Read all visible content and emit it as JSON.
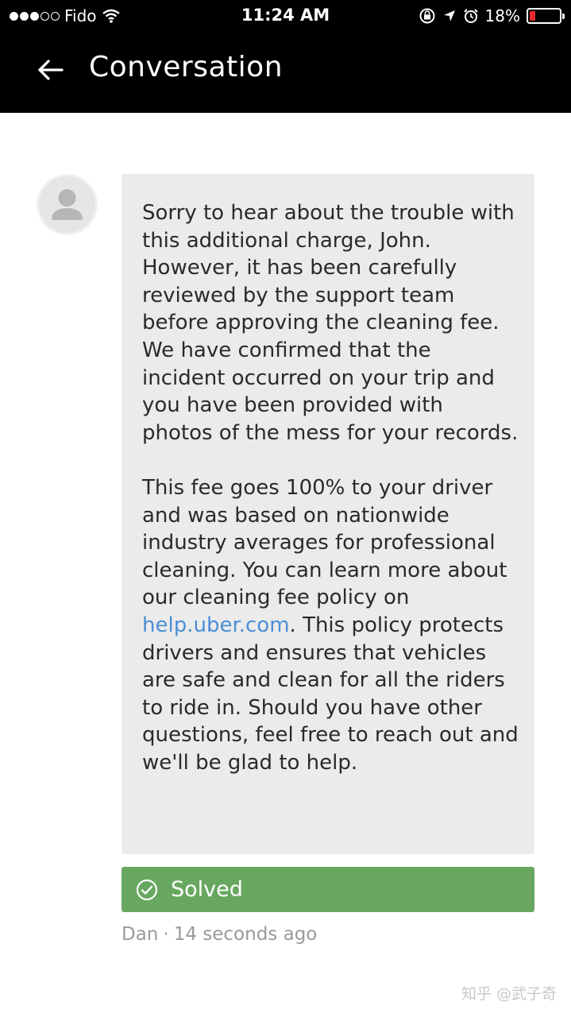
{
  "status_bar": {
    "carrier": "Fido",
    "time": "11:24 AM",
    "battery_percent": "18%",
    "battery_level": 0.18,
    "signal_strength": 3,
    "signal_max": 5,
    "icons": [
      "wifi-icon",
      "orientation-lock-icon",
      "location-icon",
      "alarm-icon",
      "battery-icon"
    ]
  },
  "nav": {
    "title": "Conversation",
    "back_icon": "back-arrow-icon"
  },
  "message": {
    "avatar_icon": "person-avatar-icon",
    "paragraph1": "Sorry to hear about the trouble with this additional charge, John. However, it has been carefully reviewed by the support team before approving the cleaning fee. We have confirmed that the incident occurred on your trip and you have been provided with photos of the mess for your records.",
    "paragraph2_before": "This fee goes 100% to your driver and was based on nationwide industry averages for professional cleaning. You can learn more about our cleaning fee policy on ",
    "link_text": "help.uber.com",
    "paragraph2_after": ". This policy protects drivers and ensures that vehicles are safe and clean for all the riders to ride in. Should you have other questions, feel free to reach out and we'll be glad to help."
  },
  "status": {
    "label": "Solved",
    "icon": "check-circle-icon",
    "color": "#68a760"
  },
  "meta": {
    "author": "Dan",
    "separator": "·",
    "time": "14 seconds ago"
  },
  "watermark": "知乎 @武子奇",
  "colors": {
    "header_bg": "#000000",
    "bubble_bg": "#ebebeb",
    "link": "#4a8fd6",
    "battery_low": "#e5282f"
  }
}
